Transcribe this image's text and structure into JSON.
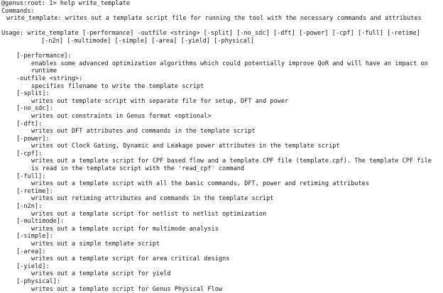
{
  "prompt": {
    "text": "@genus:root: 1> ",
    "command": "help write_template"
  },
  "header": {
    "commands_label": "Commands:",
    "summary": "write_template: writes out a template script file for running the tool with the necessary commands and attributes"
  },
  "usage": {
    "line1": "Usage: write_template [-performance] -outfile <string> [-split] [-no_sdc] [-dft] [-power] [-cpf] [-full] [-retime]",
    "line2": "[-n2n] [-multimode] [-simple] [-area] [-yield] [-physical]"
  },
  "options": [
    {
      "flag": "[-performance]:",
      "desc": [
        "enables some advanced optimization algorithms which could potentially improve QoR and will have an impact on",
        "runtime"
      ]
    },
    {
      "flag": "-outfile <string>:",
      "desc": [
        "specifies filename to write the template script"
      ]
    },
    {
      "flag": "[-split]:",
      "desc": [
        "writes out template script with separate file for setup, DFT and power"
      ]
    },
    {
      "flag": "[-no_sdc]:",
      "desc": [
        "writes out constraints in Genus format <optional>"
      ]
    },
    {
      "flag": "[-dft]:",
      "desc": [
        "writes out DFT attributes and commands in the template script"
      ]
    },
    {
      "flag": "[-power]:",
      "desc": [
        "writes out Clock Gating, Dynamic and Leakage power attributes in the template script"
      ]
    },
    {
      "flag": "[-cpf]:",
      "desc": [
        "writes out a template script for CPF based flow and a template CPF file (template.cpf). The template CPF file",
        "is read in the template script with the 'read_cpf' command"
      ]
    },
    {
      "flag": "[-full]:",
      "desc": [
        "writes out a template script with all the basic commands, DFT, power and retiming attributes"
      ]
    },
    {
      "flag": "[-retime]:",
      "desc": [
        "writes out retiming attributes and commands in the template script"
      ]
    },
    {
      "flag": "[-n2n]:",
      "desc": [
        "writes out a template script for netlist to netlist optimization"
      ]
    },
    {
      "flag": "[-multimode]:",
      "desc": [
        "writes out a template script for multimode analysis"
      ]
    },
    {
      "flag": "[-simple]:",
      "desc": [
        "writes out a simple template script"
      ]
    },
    {
      "flag": "[-area]:",
      "desc": [
        "writes out a template script for area critical designs"
      ]
    },
    {
      "flag": "[-yield]:",
      "desc": [
        "writes out a template script for yield"
      ]
    },
    {
      "flag": "[-physical]:",
      "desc": [
        "writes out a template script for Genus Physical Flow"
      ]
    }
  ]
}
